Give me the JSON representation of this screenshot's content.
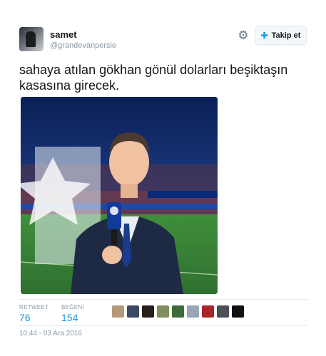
{
  "user": {
    "display_name": "samet",
    "handle": "@grandevanpersie"
  },
  "actions": {
    "gear_icon": "gear-icon",
    "follow_label": "Takip et",
    "follow_icon": "add-user-icon"
  },
  "tweet": {
    "text": "sahaya atılan gökhan gönül dolarları beşiktaşın kasasına girecek."
  },
  "media": {
    "description_icon": "photo"
  },
  "stats": {
    "retweets_label": "RETWEET",
    "retweets": "76",
    "likes_label": "BEĞENİ",
    "likes": "154"
  },
  "likers": [
    {
      "color": "#b59a7a"
    },
    {
      "color": "#3a4a63"
    },
    {
      "color": "#2a1e1a"
    },
    {
      "color": "#7f8f5e"
    },
    {
      "color": "#3d6e3a"
    },
    {
      "color": "#9aa4b5"
    },
    {
      "color": "#a8232a"
    },
    {
      "color": "#4b4f57"
    },
    {
      "color": "#111111"
    }
  ],
  "meta": {
    "timestamp": "10:44 - 03 Ara 2016"
  },
  "colors": {
    "link": "#1b95e0",
    "muted": "#8899a6",
    "border": "#e6ecf0"
  }
}
